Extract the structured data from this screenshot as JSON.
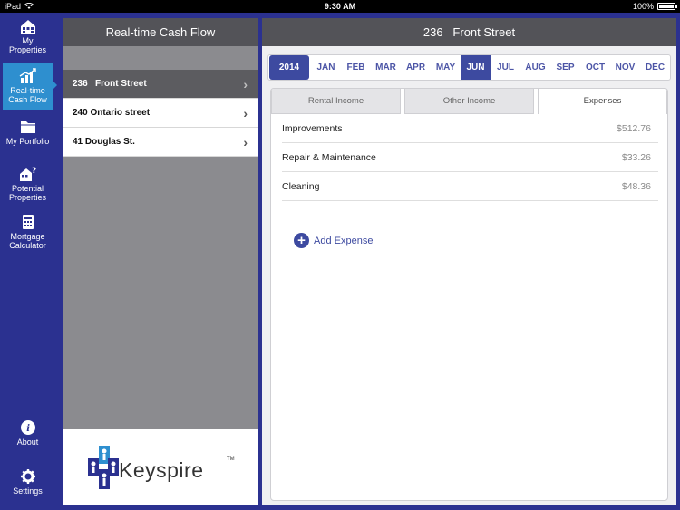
{
  "statusbar": {
    "device": "iPad",
    "time": "9:30 AM",
    "battery": "100%"
  },
  "nav": {
    "my_properties": "My Properties",
    "cash_flow": "Real-time Cash Flow",
    "my_portfolio": "My Portfolio",
    "potential_properties": "Potential Properties",
    "mortgage_calculator": "Mortgage Calculator",
    "about": "About",
    "settings": "Settings"
  },
  "middle": {
    "title": "Real-time Cash Flow",
    "properties": [
      {
        "name": "236   Front Street",
        "selected": true
      },
      {
        "name": "240 Ontario street",
        "selected": false
      },
      {
        "name": "41 Douglas St.",
        "selected": false
      }
    ],
    "logo": {
      "name": "Keyspire",
      "tm": "TM"
    }
  },
  "right": {
    "title": "236   Front Street",
    "year": "2014",
    "months": [
      "JAN",
      "FEB",
      "MAR",
      "APR",
      "MAY",
      "JUN",
      "JUL",
      "AUG",
      "SEP",
      "OCT",
      "NOV",
      "DEC"
    ],
    "selected_month": "JUN",
    "tabs": [
      "Rental Income",
      "Other Income",
      "Expenses"
    ],
    "active_tab": "Expenses",
    "expenses": [
      {
        "label": "Improvements",
        "amount": "$512.76"
      },
      {
        "label": "Repair & Maintenance",
        "amount": "$33.26"
      },
      {
        "label": "Cleaning",
        "amount": "$48.36"
      }
    ],
    "add_expense": "Add Expense"
  },
  "colors": {
    "nav_bg": "#2b3190",
    "accent": "#3d4aa0",
    "active_nav": "#2e8fcf"
  }
}
